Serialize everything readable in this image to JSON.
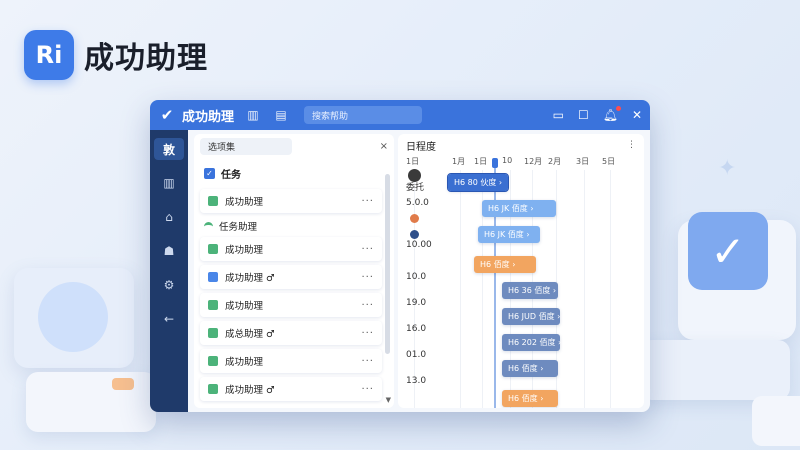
{
  "brand": {
    "logo_text": "Ri",
    "title": "成功助理"
  },
  "window": {
    "title": "成功助理",
    "search_text": "搜索帮助",
    "titlebar_icons": [
      "bar-chart-icon",
      "document-icon"
    ],
    "controls": [
      "minimize-icon",
      "maximize-icon",
      "bell-icon",
      "close-icon"
    ]
  },
  "rail": {
    "items": [
      {
        "label": "敦",
        "name": "rail-home",
        "active": true
      },
      {
        "label": "▥",
        "name": "rail-chart-icon"
      },
      {
        "label": "⌂",
        "name": "rail-building-icon"
      },
      {
        "label": "☗",
        "name": "rail-team-icon"
      },
      {
        "label": "⚙",
        "name": "rail-gear-icon"
      },
      {
        "label": "←",
        "name": "rail-back-icon"
      }
    ]
  },
  "task_panel": {
    "select_value": "选项集",
    "close_label": "×",
    "group_label": "任务",
    "subgroup_label": "任务助理",
    "more_label": "···",
    "tasks": [
      {
        "label": "成功助理",
        "icon": "green"
      },
      {
        "label": "成功助理",
        "icon": "green"
      },
      {
        "label": "成功助理 ♂",
        "icon": "blue"
      },
      {
        "label": "成功助理",
        "icon": "green"
      },
      {
        "label": "成总助理 ♂",
        "icon": "green"
      },
      {
        "label": "成功助理",
        "icon": "green"
      },
      {
        "label": "成功助理 ♂",
        "icon": "green"
      }
    ]
  },
  "gantt": {
    "title": "日程度",
    "menu_label": "⋮",
    "ticks": [
      "1日",
      "1月",
      "1日",
      "10",
      "12月",
      "2月",
      "3日",
      "5日"
    ],
    "row_labels": [
      "委托",
      "5.0.0",
      "10.00",
      "10.0",
      "19.0",
      "16.0",
      "01.0",
      "13.0"
    ],
    "bars": [
      {
        "label": "H6 80 伙度 ›",
        "color": "blue"
      },
      {
        "label": "H6 JK 佰度 ›",
        "color": "light"
      },
      {
        "label": "H6 JK 佰度 ›",
        "color": "light"
      },
      {
        "label": "H6 佰度 ›",
        "color": "orange"
      },
      {
        "label": "H6 36 佰度 ›",
        "color": "slate"
      },
      {
        "label": "H6 JUD 佰度 ›",
        "color": "slate"
      },
      {
        "label": "H6 202 佰度 ›",
        "color": "slate"
      },
      {
        "label": "H6 佰度 ›",
        "color": "slate"
      },
      {
        "label": "H6 佰度 ›",
        "color": "orange"
      }
    ]
  }
}
